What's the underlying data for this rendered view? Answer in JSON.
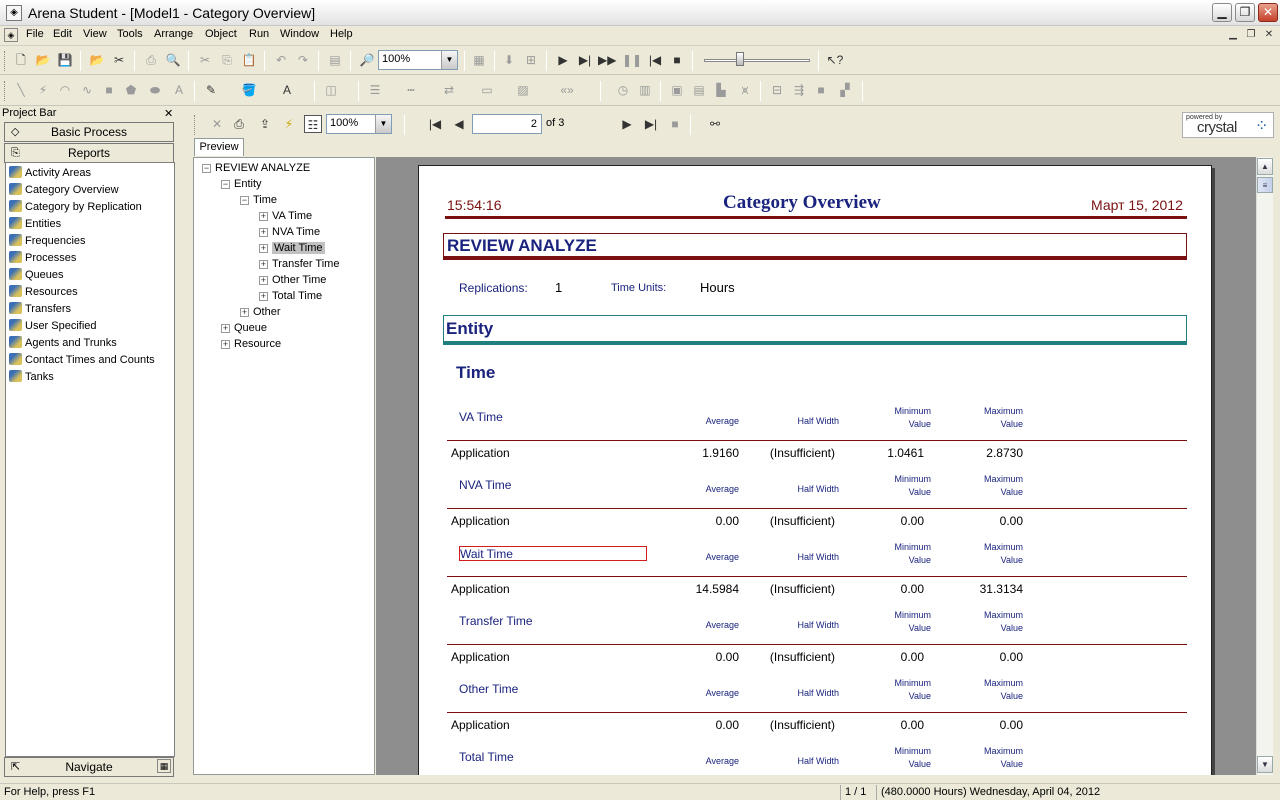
{
  "window": {
    "title": "Arena Student - [Model1 - Category Overview]"
  },
  "menu": [
    "File",
    "Edit",
    "View",
    "Tools",
    "Arrange",
    "Object",
    "Run",
    "Window",
    "Help"
  ],
  "toolbar": {
    "zoom": "100%"
  },
  "project_bar": {
    "title": "Project Bar",
    "tab_basic": "Basic Process",
    "tab_reports": "Reports",
    "items": [
      "Activity Areas",
      "Category Overview",
      "Category by Replication",
      "Entities",
      "Frequencies",
      "Processes",
      "Queues",
      "Resources",
      "Transfers",
      "User Specified",
      "Agents and Trunks",
      "Contact Times and Counts",
      "Tanks"
    ],
    "navigate": "Navigate"
  },
  "viewer": {
    "zoom": "100%",
    "page_current": "2",
    "page_of": "of 3",
    "logo_powered": "powered by",
    "logo_name": "crystal",
    "preview_tab": "Preview"
  },
  "tree": {
    "root": "REVIEW ANALYZE",
    "entity": "Entity",
    "time": "Time",
    "time_children": [
      "VA Time",
      "NVA Time",
      "Wait Time",
      "Transfer Time",
      "Other Time",
      "Total Time"
    ],
    "other": "Other",
    "queue": "Queue",
    "resource": "Resource"
  },
  "report": {
    "time": "15:54:16",
    "title": "Category Overview",
    "date": "Март 15, 2012",
    "project": "REVIEW ANALYZE",
    "replications_label": "Replications:",
    "replications": "1",
    "time_units_label": "Time Units:",
    "time_units": "Hours",
    "section": "Entity",
    "subsection": "Time",
    "headers": {
      "average": "Average",
      "half_width": "Half Width",
      "min_1": "Minimum",
      "min_2": "Value",
      "max_1": "Maximum",
      "max_2": "Value"
    },
    "rows": [
      {
        "name": "VA Time",
        "label": "Application",
        "average": "1.9160",
        "half_width": "(Insufficient)",
        "min": "1.0461",
        "max": "2.8730"
      },
      {
        "name": "NVA Time",
        "label": "Application",
        "average": "0.00",
        "half_width": "(Insufficient)",
        "min": "0.00",
        "max": "0.00"
      },
      {
        "name": "Wait Time",
        "label": "Application",
        "average": "14.5984",
        "half_width": "(Insufficient)",
        "min": "0.00",
        "max": "31.3134"
      },
      {
        "name": "Transfer Time",
        "label": "Application",
        "average": "0.00",
        "half_width": "(Insufficient)",
        "min": "0.00",
        "max": "0.00"
      },
      {
        "name": "Other Time",
        "label": "Application",
        "average": "0.00",
        "half_width": "(Insufficient)",
        "min": "0.00",
        "max": "0.00"
      },
      {
        "name": "Total Time"
      }
    ]
  },
  "status": {
    "help": "For Help, press F1",
    "pages": "1 / 1",
    "sim_time": "(480.0000 Hours) Wednesday, April 04, 2012"
  }
}
